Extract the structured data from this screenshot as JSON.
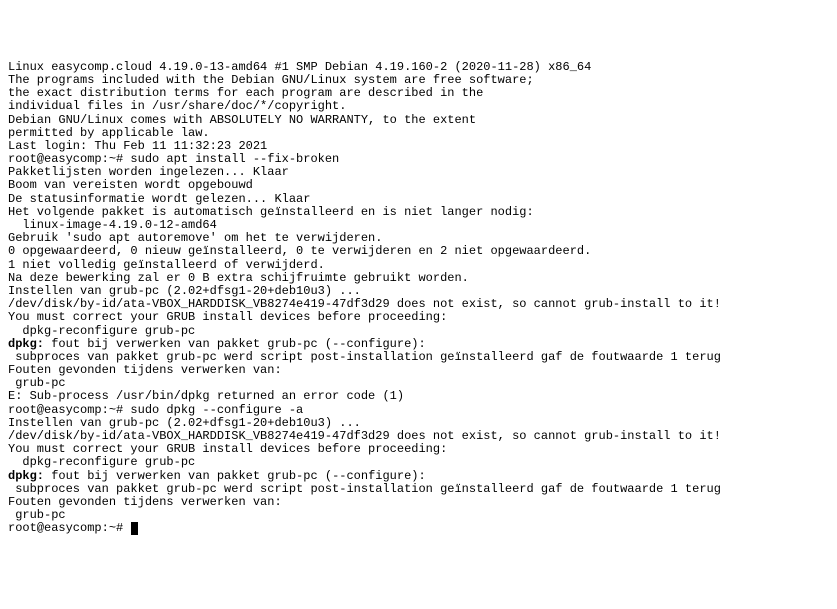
{
  "t": {
    "l1": "Linux easycomp.cloud 4.19.0-13-amd64 #1 SMP Debian 4.19.160-2 (2020-11-28) x86_64",
    "l2": "",
    "l3": "The programs included with the Debian GNU/Linux system are free software;",
    "l4": "the exact distribution terms for each program are described in the",
    "l5": "individual files in /usr/share/doc/*/copyright.",
    "l6": "",
    "l7": "Debian GNU/Linux comes with ABSOLUTELY NO WARRANTY, to the extent",
    "l8": "permitted by applicable law.",
    "l9": "Last login: Thu Feb 11 11:32:23 2021",
    "l10a": "root@easycomp:~# ",
    "l10b": "sudo apt install --fix-broken",
    "l11": "Pakketlijsten worden ingelezen... Klaar",
    "l12": "Boom van vereisten wordt opgebouwd",
    "l13": "De statusinformatie wordt gelezen... Klaar",
    "l14": "Het volgende pakket is automatisch geïnstalleerd en is niet langer nodig:",
    "l15": "  linux-image-4.19.0-12-amd64",
    "l16": "Gebruik 'sudo apt autoremove' om het te verwijderen.",
    "l17": "0 opgewaardeerd, 0 nieuw geïnstalleerd, 0 te verwijderen en 2 niet opgewaardeerd.",
    "l18": "1 niet volledig geïnstalleerd of verwijderd.",
    "l19": "Na deze bewerking zal er 0 B extra schijfruimte gebruikt worden.",
    "l20": "Instellen van grub-pc (2.02+dfsg1-20+deb10u3) ...",
    "l21": "/dev/disk/by-id/ata-VBOX_HARDDISK_VB8274e419-47df3d29 does not exist, so cannot grub-install to it!",
    "l22": "You must correct your GRUB install devices before proceeding:",
    "l23": "",
    "l24": "  dpkg-reconfigure grub-pc",
    "l25a": "dpkg:",
    "l25b": " fout bij verwerken van pakket grub-pc (--configure):",
    "l26": " subproces van pakket grub-pc werd script post-installation geïnstalleerd gaf de foutwaarde 1 terug",
    "l27": "Fouten gevonden tijdens verwerken van:",
    "l28": " grub-pc",
    "l29": "E: Sub-process /usr/bin/dpkg returned an error code (1)",
    "l30a": "root@easycomp:~# ",
    "l30b": "sudo dpkg --configure -a",
    "l31": "Instellen van grub-pc (2.02+dfsg1-20+deb10u3) ...",
    "l32": "/dev/disk/by-id/ata-VBOX_HARDDISK_VB8274e419-47df3d29 does not exist, so cannot grub-install to it!",
    "l33": "You must correct your GRUB install devices before proceeding:",
    "l34": "",
    "l35": "  dpkg-reconfigure grub-pc",
    "l36a": "dpkg:",
    "l36b": " fout bij verwerken van pakket grub-pc (--configure):",
    "l37": " subproces van pakket grub-pc werd script post-installation geïnstalleerd gaf de foutwaarde 1 terug",
    "l38": "Fouten gevonden tijdens verwerken van:",
    "l39": " grub-pc",
    "l40": "root@easycomp:~# "
  }
}
